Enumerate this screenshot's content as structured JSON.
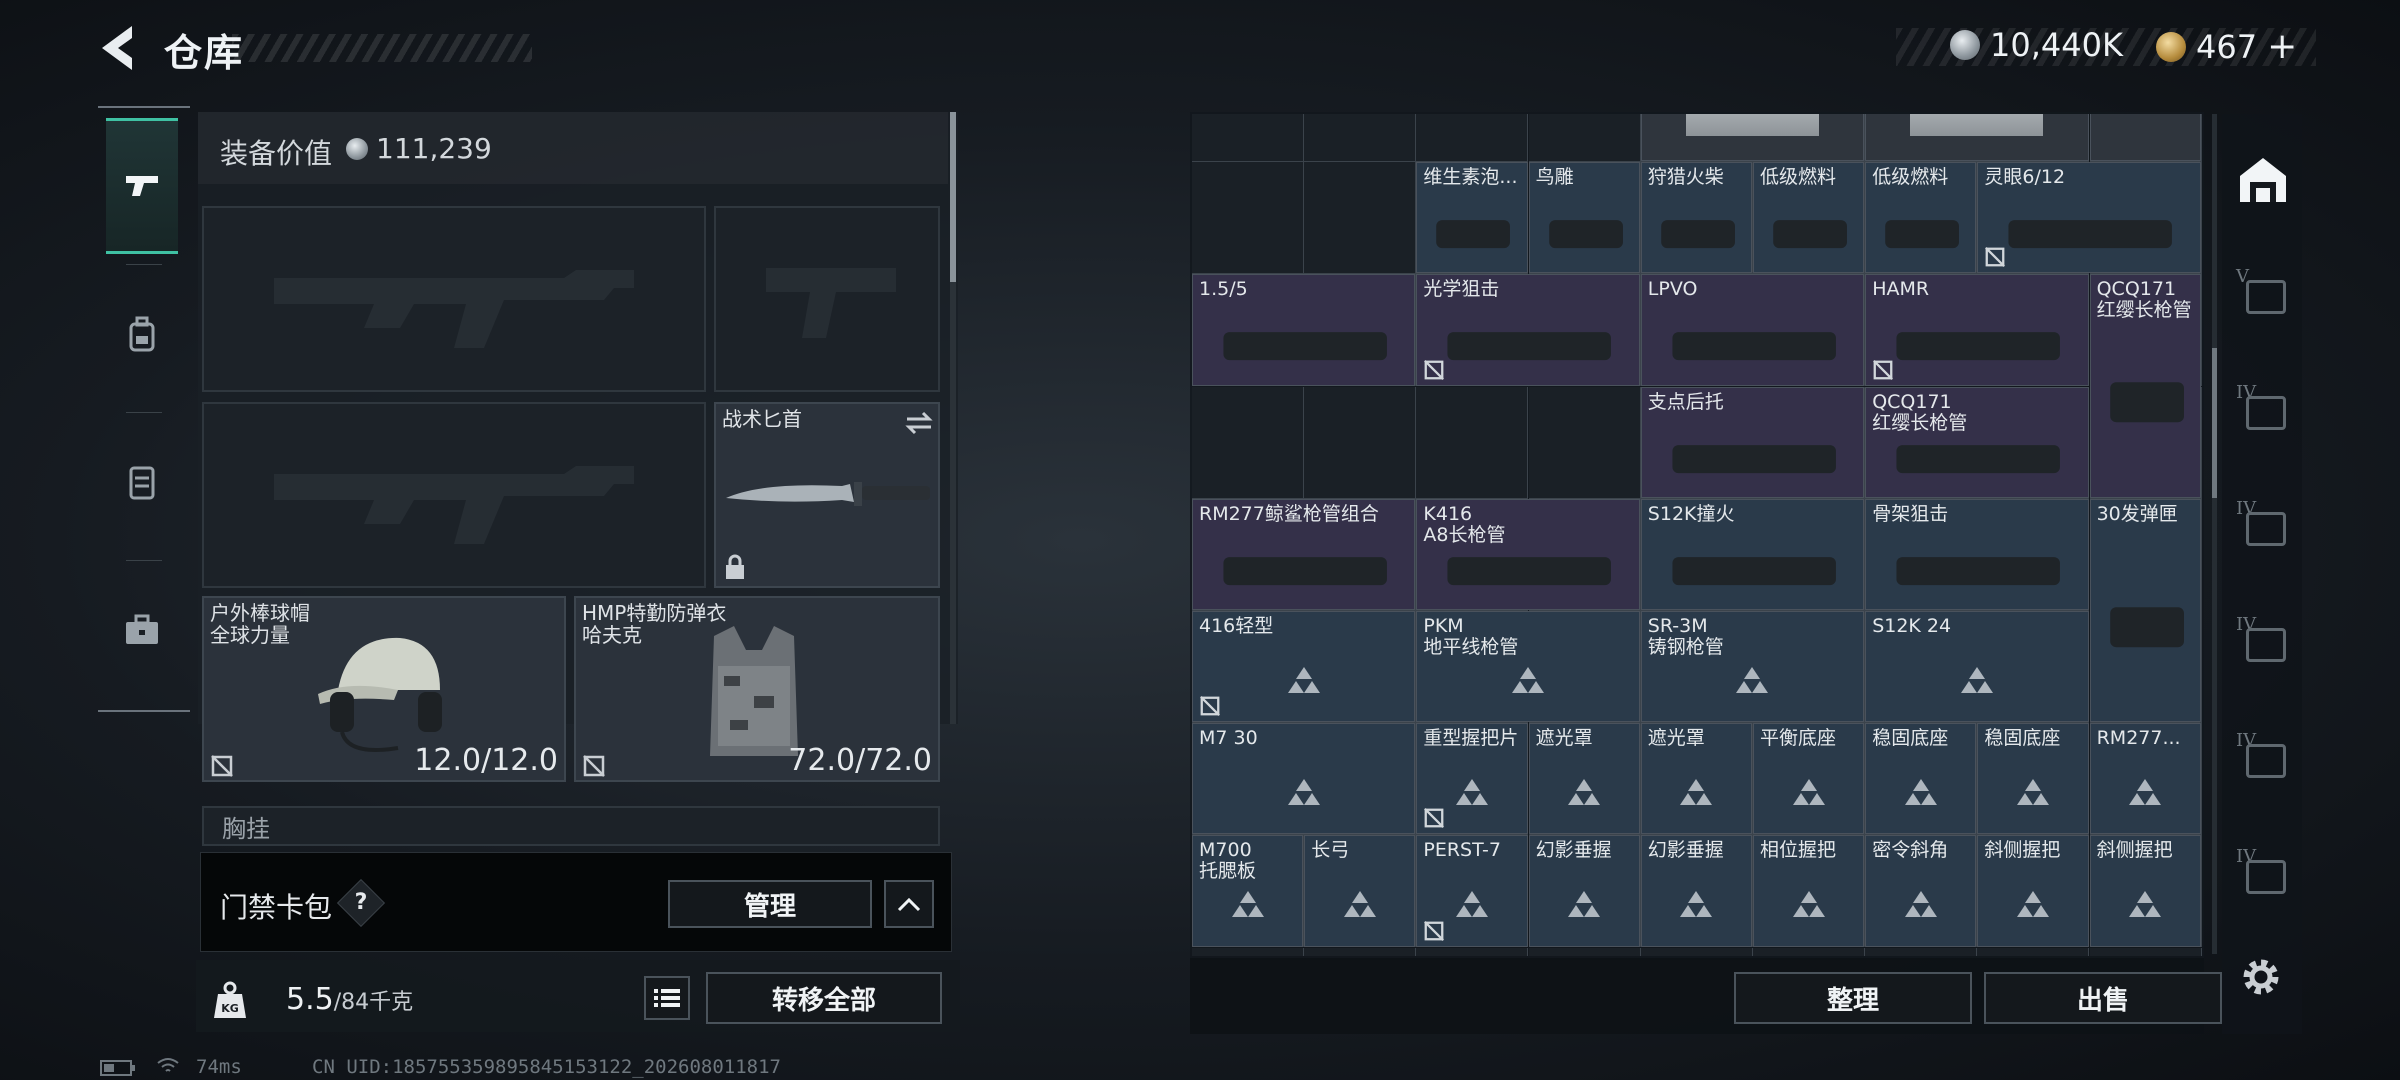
{
  "header": {
    "title": "仓库",
    "coin_value": "10,440K",
    "gold_value": "467",
    "plus_label": "+"
  },
  "equipment": {
    "value_label": "装备价值",
    "value": "111,239",
    "knife_label": "战术匕首",
    "helmet_name": "户外棒球帽",
    "helmet_brand": "全球力量",
    "helmet_durability": "12.0/12.0",
    "vest_name": "HMP特勤防弹衣",
    "vest_brand": "哈夫克",
    "vest_durability": "72.0/72.0",
    "chest_rig_label": "胸挂"
  },
  "keycard": {
    "label": "门禁卡包",
    "help": "?",
    "manage_label": "管理"
  },
  "capacity": {
    "weight": "5.5",
    "capacity": "/84千克",
    "transfer_all_label": "转移全部"
  },
  "status_bar": {
    "ping": "74ms",
    "uid": "CN UID:185755359895845153122_202608011817"
  },
  "grid_items": [
    {
      "name": "维生素泡...",
      "style": "blue"
    },
    {
      "name": "鸟雕",
      "style": "blue"
    },
    {
      "name": "狩猎火柴",
      "style": "blue"
    },
    {
      "name": "低级燃料",
      "style": "blue"
    },
    {
      "name": "低级燃料",
      "style": "blue"
    },
    {
      "name": "灵眼6/12",
      "style": "blue"
    },
    {
      "name": "1.5/5",
      "style": "purple"
    },
    {
      "name": "光学狙击",
      "style": "purple"
    },
    {
      "name": "LPVO",
      "style": "purple"
    },
    {
      "name": "HAMR",
      "style": "purple"
    },
    {
      "name": "QCQ171",
      "sub": "红缨长枪管",
      "style": "purple"
    },
    {
      "name": "支点后托",
      "style": "purple"
    },
    {
      "name": "QCQ171",
      "sub": "红缨长枪管",
      "style": "purple"
    },
    {
      "name": "RM277鲸鲨枪管组合",
      "style": "purple"
    },
    {
      "name": "K416",
      "sub": "A8长枪管",
      "style": "purple"
    },
    {
      "name": "S12K撞火",
      "style": "blue"
    },
    {
      "name": "骨架狙击",
      "style": "blue"
    },
    {
      "name": "30发弹匣",
      "style": "blue"
    },
    {
      "name": "416轻型",
      "style": "blue"
    },
    {
      "name": "PKM",
      "sub": "地平线枪管",
      "style": "blue"
    },
    {
      "name": "SR-3M",
      "sub": "铸钢枪管",
      "style": "blue"
    },
    {
      "name": "S12K 24",
      "style": "blue"
    },
    {
      "name": "M7 30",
      "style": "blue"
    },
    {
      "name": "重型握把片",
      "style": "blue"
    },
    {
      "name": "遮光罩",
      "style": "blue"
    },
    {
      "name": "遮光罩",
      "style": "blue"
    },
    {
      "name": "平衡底座",
      "style": "blue"
    },
    {
      "name": "稳固底座",
      "style": "blue"
    },
    {
      "name": "稳固底座",
      "style": "blue"
    },
    {
      "name": "RM277...",
      "style": "blue"
    },
    {
      "name": "M700",
      "sub": "托腮板",
      "style": "blue"
    },
    {
      "name": "长弓",
      "style": "blue"
    },
    {
      "name": "PERST-7",
      "style": "blue"
    },
    {
      "name": "幻影垂握",
      "style": "blue"
    },
    {
      "name": "幻影垂握",
      "style": "blue"
    },
    {
      "name": "相位握把",
      "style": "blue"
    },
    {
      "name": "密令斜角",
      "style": "blue"
    },
    {
      "name": "斜侧握把",
      "style": "blue"
    },
    {
      "name": "斜侧握把",
      "style": "blue"
    }
  ],
  "actions": {
    "sort_label": "整理",
    "sell_label": "出售"
  },
  "right_tabs": {
    "roman": [
      "V",
      "IV",
      "IV",
      "IV",
      "IV",
      "IV"
    ]
  }
}
